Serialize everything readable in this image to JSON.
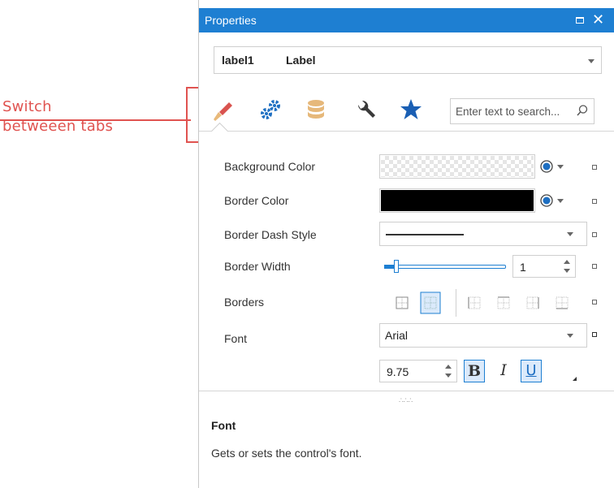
{
  "annotation": {
    "line1": "Switch",
    "line2": "betweeen tabs"
  },
  "panel": {
    "title": "Properties",
    "object_selector": {
      "name": "label1",
      "type": "Label"
    },
    "tabs": [
      {
        "icon": "paintbrush-icon",
        "selected": true
      },
      {
        "icon": "gears-icon"
      },
      {
        "icon": "database-icon"
      },
      {
        "icon": "wrench-icon"
      },
      {
        "icon": "star-icon"
      }
    ],
    "search_placeholder": "Enter text to search..."
  },
  "properties": {
    "background_color": {
      "label": "Background Color"
    },
    "border_color": {
      "label": "Border Color"
    },
    "border_dash_style": {
      "label": "Border Dash Style"
    },
    "border_width": {
      "label": "Border Width",
      "value": "1"
    },
    "borders": {
      "label": "Borders"
    },
    "font": {
      "label": "Font",
      "family": "Arial",
      "size": "9.75",
      "bold": "B",
      "italic": "I",
      "underline": "U"
    }
  },
  "description": {
    "title": "Font",
    "text": "Gets or sets the control's font."
  },
  "colors": {
    "accent": "#1e7fd2",
    "annotation": "#e05350",
    "tab_brush_handle": "#e8b97a",
    "tab_brush_tip": "#d9534f",
    "tab_gears": "#1e6fc2",
    "tab_database": "#e6b87a",
    "tab_wrench": "#3a3a3a",
    "tab_star": "#1a5fb4"
  }
}
